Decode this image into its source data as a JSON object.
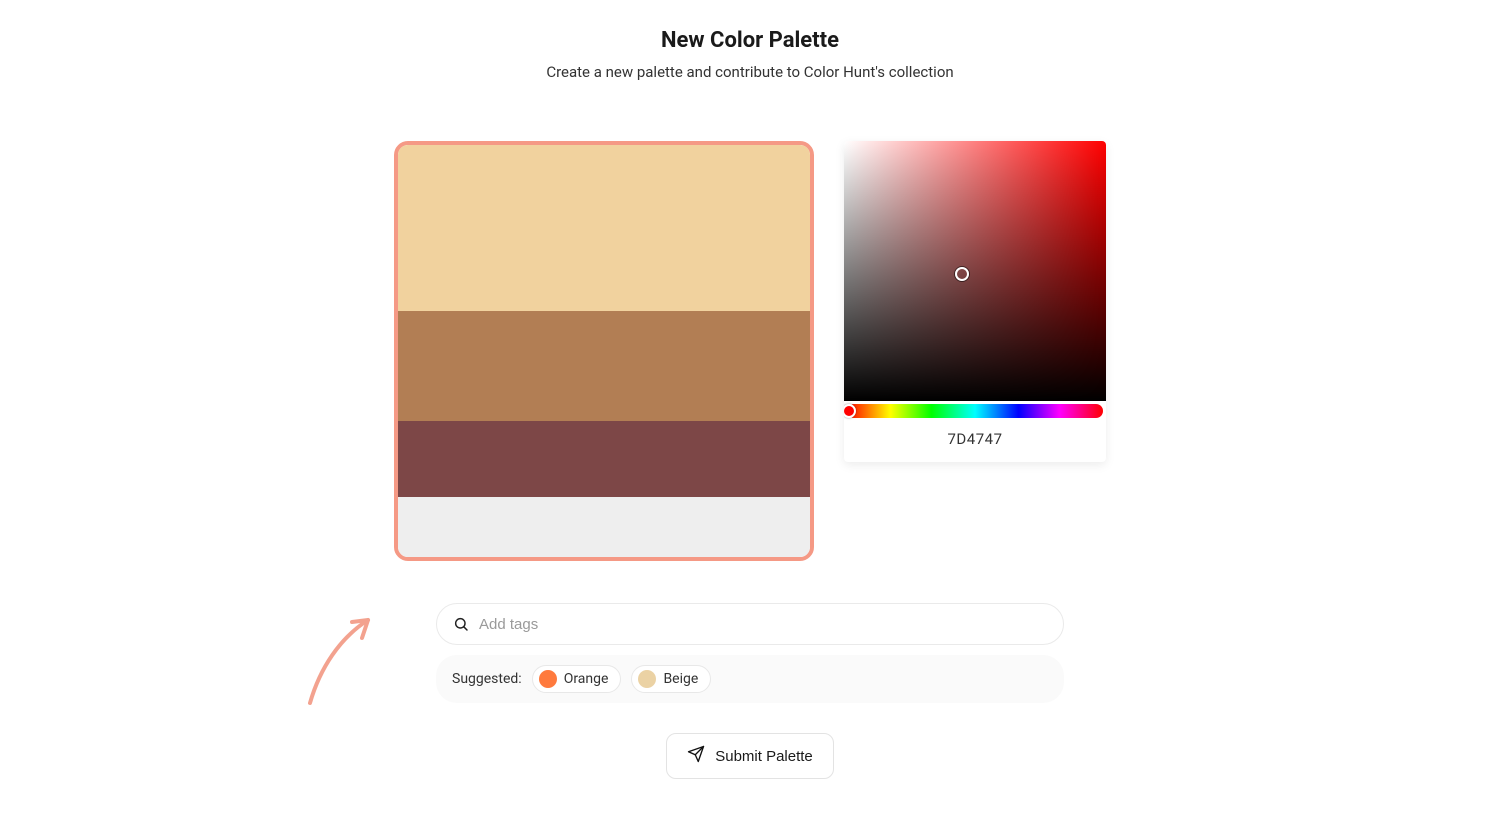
{
  "header": {
    "title": "New Color Palette",
    "subtitle": "Create a new palette and contribute to Color Hunt's collection"
  },
  "palette": {
    "border_color": "#f59985",
    "swatches": [
      "#f1d29e",
      "#b27e54",
      "#7d4747",
      "#eeeeee"
    ]
  },
  "picker": {
    "hex_value": "7D4747"
  },
  "tags": {
    "placeholder": "Add tags",
    "suggested_label": "Suggested:",
    "suggested": [
      {
        "label": "Orange",
        "color": "#ff7a3d"
      },
      {
        "label": "Beige",
        "color": "#ebd2a4"
      }
    ]
  },
  "submit": {
    "label": "Submit Palette"
  }
}
